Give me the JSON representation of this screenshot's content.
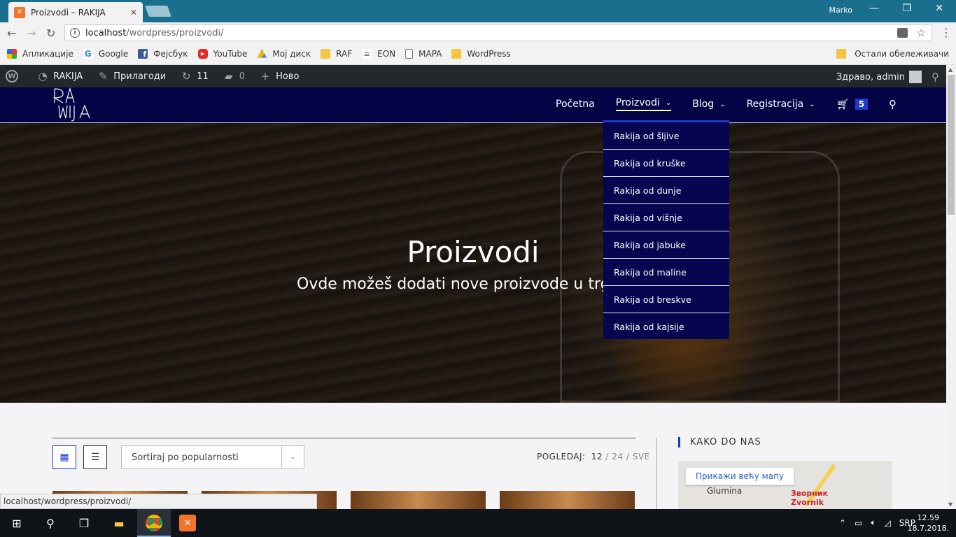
{
  "browser": {
    "tab_title": "Proizvodi – RAKIJA",
    "tab_close": "✕",
    "window_user": "Marko",
    "url_host": "localhost",
    "url_path": "/wordpress/proizvodi/"
  },
  "bookmarks": {
    "items": [
      {
        "label": "Апликације",
        "icon": "apps-grid-icon"
      },
      {
        "label": "Google",
        "icon": "google-icon"
      },
      {
        "label": "Фејсбук",
        "icon": "facebook-icon"
      },
      {
        "label": "YouTube",
        "icon": "youtube-icon"
      },
      {
        "label": "Мој диск",
        "icon": "drive-icon"
      },
      {
        "label": "RAF",
        "icon": "folder-icon"
      },
      {
        "label": "EON",
        "icon": "eon-icon"
      },
      {
        "label": "MAPA",
        "icon": "page-icon"
      },
      {
        "label": "WordPress",
        "icon": "folder-icon"
      }
    ],
    "other": "Остали обележивачи"
  },
  "wp_admin": {
    "site_name": "RAKIJA",
    "customize": "Прилагоди",
    "updates_count": "11",
    "comments_count": "0",
    "new_label": "Ново",
    "greeting": "Здраво, admin"
  },
  "site_nav": {
    "items": [
      {
        "label": "Početna",
        "has_dropdown": false
      },
      {
        "label": "Proizvodi",
        "has_dropdown": true,
        "active": true
      },
      {
        "label": "Blog",
        "has_dropdown": true
      },
      {
        "label": "Registracija",
        "has_dropdown": true
      }
    ],
    "cart_count": "5"
  },
  "dropdown": {
    "items": [
      "Rakija od šljive",
      "Rakija od kruške",
      "Rakija od dunje",
      "Rakija od višnje",
      "Rakija od jabuke",
      "Rakija od maline",
      "Rakija od breskve",
      "Rakija od kajsije"
    ]
  },
  "hero": {
    "title": "Proizvodi",
    "subtitle": "Ovde možeš dodati nove proizvode u trg"
  },
  "shop": {
    "sort_label": "Sortiraj po popularnosti",
    "view_label": "POGLEDAJ:",
    "view_current": "12",
    "view_sep1": " / ",
    "view_24": "24",
    "view_sep2": " / ",
    "view_all": "SVE"
  },
  "sidebar": {
    "widget_title": "KAKO DO NAS",
    "map_button": "Прикажи већу мапу",
    "map_place1": "Glumina",
    "map_place2_line1": "Зворник",
    "map_place2_line2": "Zvornik"
  },
  "status_url": "localhost/wordpress/proizvodi/",
  "taskbar": {
    "lang": "SRP",
    "time": "12.59",
    "date": "18.7.2018."
  },
  "colors": {
    "header_bg": "#030345",
    "dropdown_bg": "#060650",
    "accent": "#1d3acd",
    "wp_bar": "#23282d",
    "chrome_titlebar": "#1a6e8e"
  }
}
